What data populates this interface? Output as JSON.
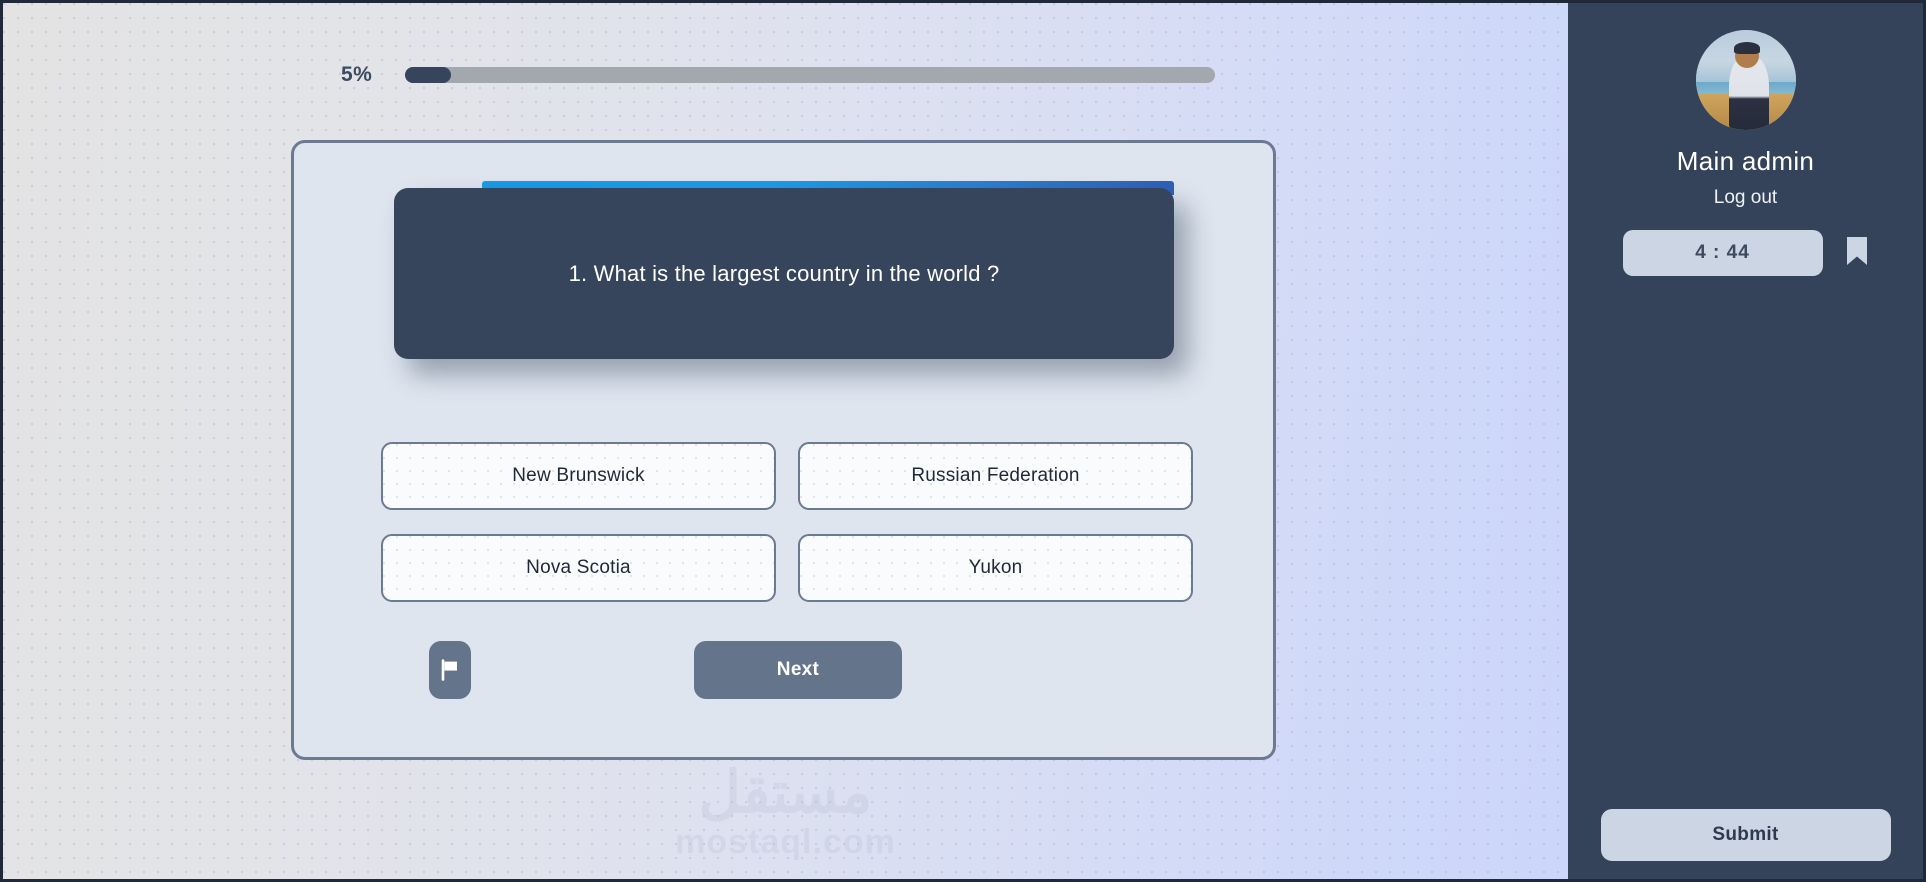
{
  "progress": {
    "percent_label": "5%",
    "percent_value": 5
  },
  "question": {
    "text": "1. What is the largest country in the world ?",
    "accent_color": "#179ce9",
    "card_color": "#36455c"
  },
  "options": [
    {
      "label": "New Brunswick"
    },
    {
      "label": "Russian Federation"
    },
    {
      "label": "Nova Scotia"
    },
    {
      "label": "Yukon"
    }
  ],
  "actions": {
    "flag_icon": "flag-icon",
    "next_label": "Next"
  },
  "sidebar": {
    "avatar_icon": "user-avatar-photo",
    "user_name": "Main admin",
    "logout_label": "Log out",
    "timer_label": "4 : 44",
    "bookmark_icon": "bookmark-icon",
    "submit_label": "Submit"
  },
  "watermark": {
    "arabic": "مستقل",
    "latin": "mostaql.com"
  },
  "colors": {
    "sidebar_bg": "#34425a",
    "card_bg": "#dee5ef",
    "card_border": "#6c7a91",
    "accent_blue": "#179ce9",
    "button_slate": "#64748b",
    "pill_light": "#ccd5e3"
  }
}
